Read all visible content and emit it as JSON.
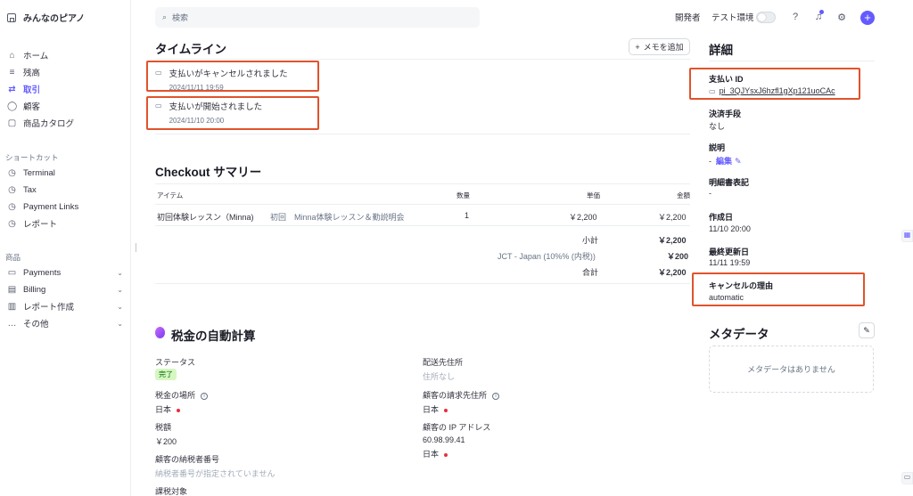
{
  "sidebar": {
    "brand": "みんなのピアノ",
    "main_items": [
      {
        "label": "ホーム",
        "icon": "⌂"
      },
      {
        "label": "残高",
        "icon": "≡"
      },
      {
        "label": "取引",
        "icon": "⇄"
      },
      {
        "label": "顧客",
        "icon": "◯"
      },
      {
        "label": "商品カタログ",
        "icon": "▢"
      }
    ],
    "shortcuts_label": "ショートカット",
    "shortcuts": [
      {
        "label": "Terminal",
        "icon": "◷"
      },
      {
        "label": "Tax",
        "icon": "◷"
      },
      {
        "label": "Payment Links",
        "icon": "◷"
      },
      {
        "label": "レポート",
        "icon": "◷"
      }
    ],
    "products_label": "商品",
    "products": [
      {
        "label": "Payments",
        "icon": "▭"
      },
      {
        "label": "Billing",
        "icon": "▤"
      },
      {
        "label": "レポート作成",
        "icon": "▥"
      },
      {
        "label": "その他",
        "icon": "…"
      }
    ]
  },
  "topbar": {
    "search_placeholder": "検索",
    "developer": "開発者",
    "test_env": "テスト環境"
  },
  "timeline": {
    "title": "タイムライン",
    "memo_button": "メモを追加",
    "events": [
      {
        "title": "支払いがキャンセルされました",
        "date": "2024/11/11 19:59"
      },
      {
        "title": "支払いが開始されました",
        "date": "2024/11/10 20:00"
      }
    ]
  },
  "checkout": {
    "title": "Checkout サマリー",
    "headers": {
      "item": "アイテム",
      "qty": "数量",
      "unit": "単価",
      "amount": "金額"
    },
    "row": {
      "name": "初回体験レッスン（Minna)",
      "desc": "初回　Minna体験レッスン＆勤説明会",
      "qty": "1",
      "unit": "￥2,200",
      "amount": "￥2,200"
    },
    "subtotal_label": "小計",
    "subtotal": "￥2,200",
    "tax_label": "JCT - Japan (10%% (内税))",
    "tax": "￥200",
    "total_label": "合計",
    "total": "￥2,200"
  },
  "tax": {
    "title": "税金の自動計算",
    "status_label": "ステータス",
    "status_value": "完了",
    "location_label": "税金の場所",
    "location_value": "日本",
    "amount_label": "税額",
    "amount_value": "￥200",
    "taxid_label": "顧客の納税者番号",
    "taxid_value": "納税者番号が指定されていません",
    "taxable_label": "課税対象",
    "ship_label": "配送先住所",
    "ship_value": "住所なし",
    "billing_label": "顧客の請求先住所",
    "billing_value": "日本",
    "ip_label": "顧客の IP アドレス",
    "ip_value": "60.98.99.41",
    "ip_country": "日本"
  },
  "details": {
    "title": "詳細",
    "payment_id_label": "支払い ID",
    "payment_id": "pi_3QJYsxJ6hzfl1gXp121uoCAc",
    "method_label": "決済手段",
    "method_value": "なし",
    "desc_label": "説明",
    "desc_value": "-",
    "edit_label": "編集",
    "statement_label": "明細書表記",
    "statement_value": "-",
    "created_label": "作成日",
    "created_value": "11/10 20:00",
    "updated_label": "最終更新日",
    "updated_value": "11/11 19:59",
    "cancel_label": "キャンセルの理由",
    "cancel_value": "automatic"
  },
  "metadata": {
    "title": "メタデータ",
    "empty": "メタデータはありません"
  },
  "colors": {
    "accent": "#635bff",
    "highlight": "#e0532c",
    "success_bg": "#d7f7c2"
  }
}
